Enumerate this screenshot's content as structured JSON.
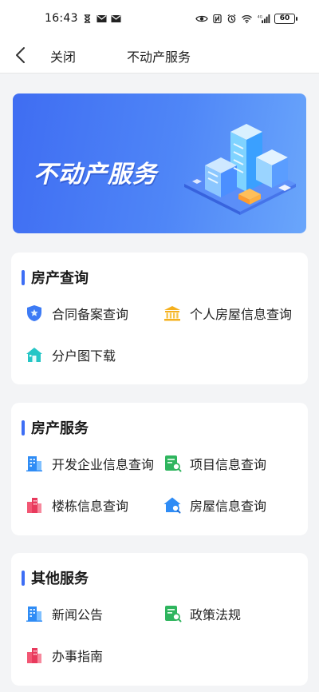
{
  "status_bar": {
    "time": "16:43",
    "battery": "60"
  },
  "nav": {
    "close_label": "关闭",
    "title": "不动产服务"
  },
  "banner": {
    "title": "不动产服务"
  },
  "sections": [
    {
      "title": "房产查询",
      "items": [
        {
          "label": "合同备案查询",
          "icon": "shield-star-icon"
        },
        {
          "label": "个人房屋信息查询",
          "icon": "bank-building-icon"
        },
        {
          "label": "分户图下载",
          "icon": "house-icon"
        }
      ]
    },
    {
      "title": "房产服务",
      "items": [
        {
          "label": "开发企业信息查询",
          "icon": "office-building-icon"
        },
        {
          "label": "项目信息查询",
          "icon": "document-search-icon"
        },
        {
          "label": "楼栋信息查询",
          "icon": "city-buildings-icon"
        },
        {
          "label": "房屋信息查询",
          "icon": "house-search-icon"
        }
      ]
    },
    {
      "title": "其他服务",
      "items": [
        {
          "label": "新闻公告",
          "icon": "office-building-icon"
        },
        {
          "label": "政策法规",
          "icon": "document-search-icon"
        },
        {
          "label": "办事指南",
          "icon": "city-buildings-icon"
        }
      ]
    }
  ],
  "colors": {
    "accent": "#3d6ef5",
    "banner_start": "#3f6df2",
    "banner_end": "#6aa6fb",
    "background": "#f3f4f6"
  }
}
